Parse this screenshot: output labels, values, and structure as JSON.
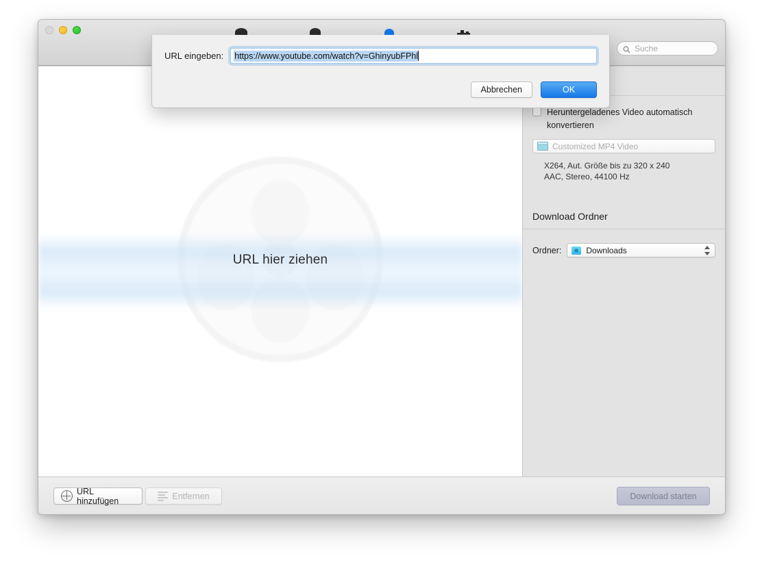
{
  "window": {
    "traffic_lights": [
      "close",
      "minimize",
      "maximize"
    ]
  },
  "toolbar": {
    "icons": [
      {
        "name": "download-tab-icon",
        "selected": false
      },
      {
        "name": "convert-tab-icon",
        "selected": false
      },
      {
        "name": "record-tab-icon",
        "selected": true
      },
      {
        "name": "settings-tab-icon",
        "selected": false
      }
    ],
    "search": {
      "placeholder": "Suche",
      "value": "",
      "icon": "search-icon"
    }
  },
  "main": {
    "dropzone_label": "URL hier ziehen",
    "watermark_icon": "film-reel-icon"
  },
  "sidebar": {
    "convert_checkbox": {
      "label": "Heruntergeladenes Video automatisch konvertieren",
      "checked": false
    },
    "format_popup": {
      "label": "Customized MP4 Video",
      "icon": "film-clapper-icon",
      "enabled": false
    },
    "codec_info_line1": "X264, Aut. Größe bis zu 320 x 240",
    "codec_info_line2": "AAC, Stereo, 44100 Hz",
    "download_folder_title": "Download Ordner",
    "folder_row": {
      "label": "Ordner:",
      "value": "Downloads",
      "icon": "downloads-folder-icon"
    }
  },
  "bottombar": {
    "add_url_label": "URL hinzufügen",
    "add_url_icon": "globe-icon",
    "remove_label": "Entfernen",
    "remove_icon": "list-icon",
    "remove_enabled": false,
    "download_label": "Download starten",
    "download_enabled": false
  },
  "dialog": {
    "label": "URL eingeben:",
    "url_value": "https://www.youtube.com/watch?v=GhinyubFPhl",
    "url_placeholder": "",
    "cancel_label": "Abbrechen",
    "ok_label": "OK"
  },
  "colors": {
    "accent_blue": "#1478e8",
    "selection_blue": "#b9d6f2",
    "focus_ring": "#6cabe4",
    "toolbar_bg": "#d9d9d9",
    "sidebar_bg": "#e3e3e3"
  }
}
